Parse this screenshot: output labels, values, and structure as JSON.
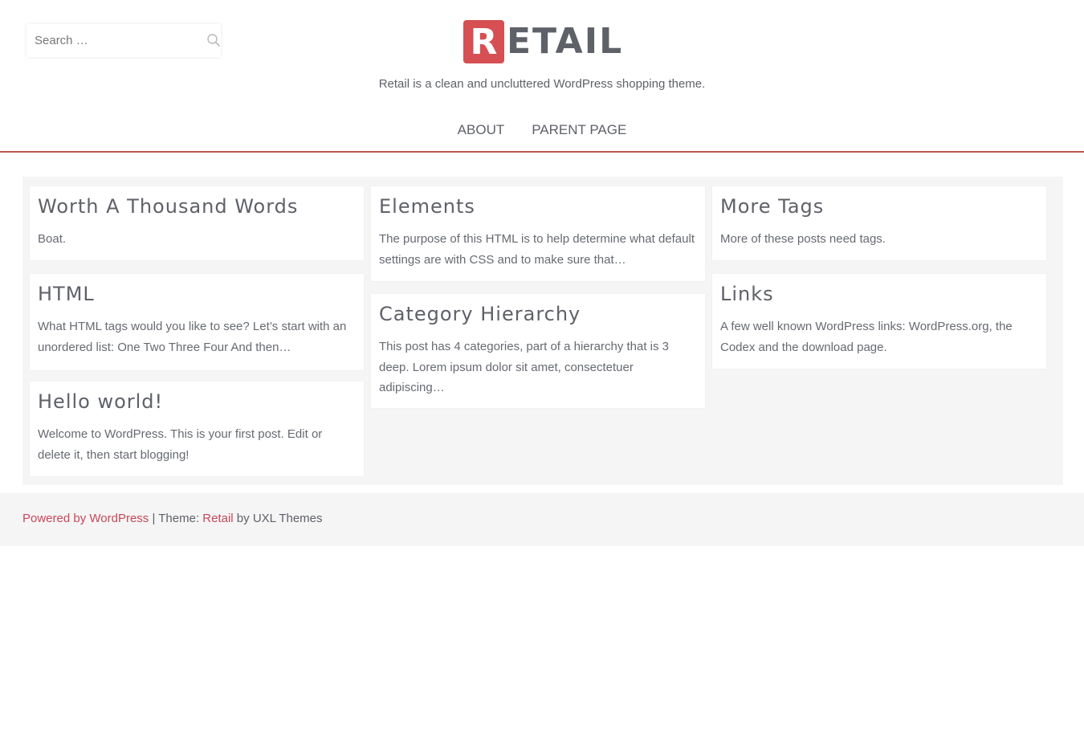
{
  "search": {
    "placeholder": "Search …"
  },
  "site": {
    "logo_letter": "R",
    "logo_rest": "ETAIL",
    "tagline": "Retail is a clean and uncluttered WordPress shopping theme."
  },
  "nav": [
    {
      "label": "ABOUT"
    },
    {
      "label": "PARENT PAGE"
    }
  ],
  "posts": [
    {
      "title": "Worth A Thousand Words",
      "excerpt": "Boat."
    },
    {
      "title": "HTML",
      "excerpt": "What HTML tags would you like to see? Let’s start with an unordered list: One Two Three Four And then…"
    },
    {
      "title": "Hello world!",
      "excerpt": "Welcome to WordPress. This is your first post. Edit or delete it, then start blogging!"
    },
    {
      "title": "Elements",
      "excerpt": "The purpose of this HTML is to help determine what default settings are with CSS and to make sure that…"
    },
    {
      "title": "Category Hierarchy",
      "excerpt": "This post has 4 categories, part of a hierarchy that is 3 deep. Lorem ipsum dolor sit amet, consectetuer adipiscing…"
    },
    {
      "title": "More Tags",
      "excerpt": "More of these posts need tags."
    },
    {
      "title": "Links",
      "excerpt": "A few well known WordPress links: WordPress.org, the Codex and the download page."
    }
  ],
  "footer": {
    "powered_by": "Powered by WordPress",
    "separator": " | Theme: ",
    "theme_name": "Retail",
    "by_text": " by UXL Themes"
  },
  "colors": {
    "accent": "#d54f53",
    "border": "#c0564d",
    "link": "#c7475b",
    "text": "#5f6168",
    "panel": "#f5f5f5"
  }
}
